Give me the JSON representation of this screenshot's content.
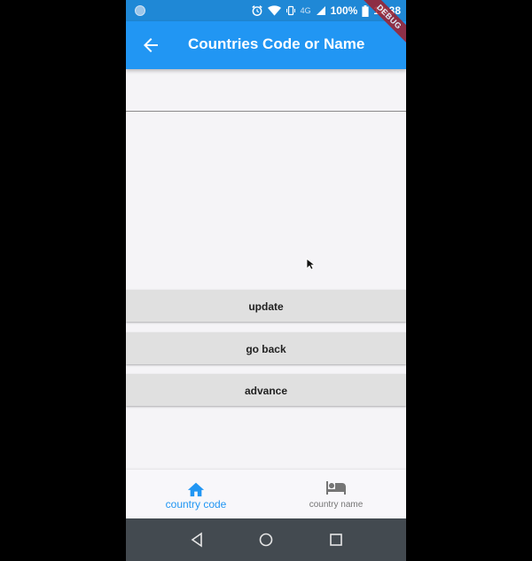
{
  "status_bar": {
    "network": "4G",
    "battery": "100%",
    "time": "18:38"
  },
  "debug_banner": "DEBUG",
  "app_bar": {
    "title": "Countries Code or Name",
    "back_icon": "arrow-back-icon"
  },
  "text_field": {
    "value": ""
  },
  "buttons": {
    "update": "update",
    "go_back": "go back",
    "advance": "advance"
  },
  "bottom_nav": {
    "items": [
      {
        "label": "country code",
        "icon": "home-icon",
        "active": true
      },
      {
        "label": "country name",
        "icon": "hotel-bed-icon",
        "active": false
      }
    ]
  },
  "system_nav": {
    "icons": [
      "triangle-back-icon",
      "circle-home-icon",
      "square-recents-icon"
    ]
  },
  "colors": {
    "primary": "#2196f3",
    "status_bar": "#1f88d6",
    "background": "#f5f4f7",
    "button": "#e0e0e0",
    "inactive_nav": "#757575",
    "system_nav": "#434a50"
  }
}
